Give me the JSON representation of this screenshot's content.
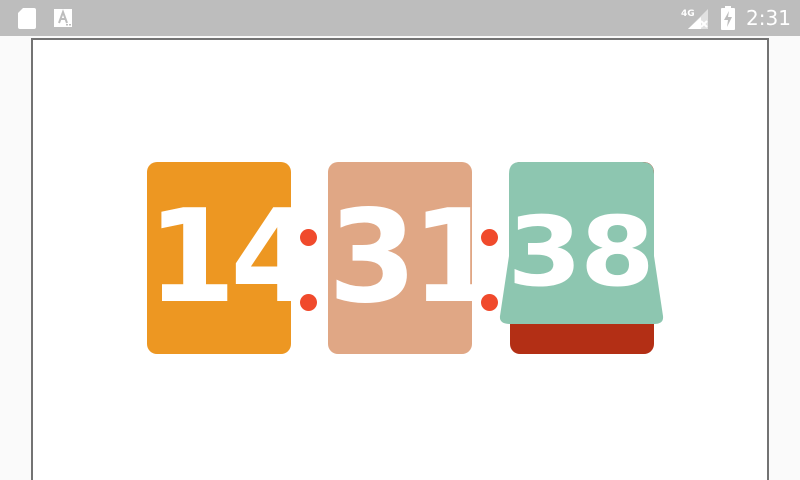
{
  "status_bar": {
    "time": "2:31",
    "network_label": "4G",
    "icons": [
      "sd-card-icon",
      "a-icon",
      "signal-icon",
      "battery-charging-icon"
    ]
  },
  "clock": {
    "hours": "14",
    "minutes": "31",
    "seconds": "38"
  },
  "colors": {
    "status_bar": "#bdbdbd",
    "hours_card": "#ed9722",
    "minutes_card": "#e0a785",
    "seconds_card": "#8dc6b0",
    "seconds_back": "#b32f15",
    "colon_dot": "#f04a2c",
    "frame_border": "#737373"
  }
}
